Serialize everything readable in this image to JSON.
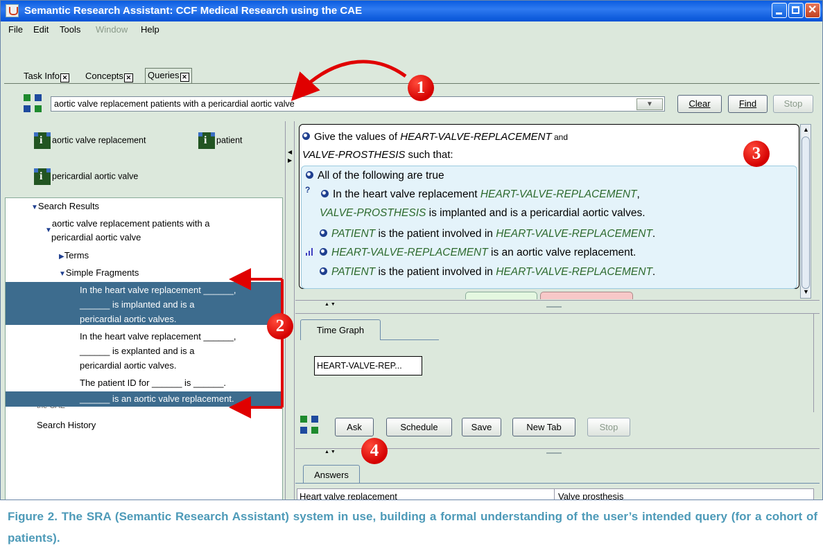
{
  "window": {
    "title": "Semantic Research Assistant: CCF Medical Research using the CAE"
  },
  "menu": [
    "File",
    "Edit",
    "Tools",
    "Window",
    "Help"
  ],
  "tabs": [
    "Task Info",
    "Concepts",
    "Queries"
  ],
  "query_bar": {
    "value": "aortic valve replacement  patients with a pericardial aortic valve",
    "dropdown_glyph": "▼",
    "clear_label": "Clear",
    "find_label": "Find",
    "stop_label": "Stop"
  },
  "concepts": [
    "aortic valve replacement",
    "patient",
    "pericardial aortic valve"
  ],
  "tree": {
    "search_results": "Search Results",
    "query_line1": "aortic valve replacement patients with a",
    "query_line2": "pericardial aortic valve",
    "terms": "Terms",
    "simple_fragments": "Simple Fragments",
    "frag1_line1": "In the heart valve replacement ______,",
    "frag1_line2": "______ is implanted and is a",
    "frag1_line3": "pericardial aortic valves.",
    "frag2_line1": "In the heart valve replacement ______,",
    "frag2_line2": "______ is explanted and is a",
    "frag2_line3": "pericardial aortic valves.",
    "frag3_line1": "The patient ID for ______ is ______.",
    "frag4_line1": "______ is an aortic valve replacement.",
    "partial_line": "the CAE",
    "search_history": "Search History"
  },
  "query_pane": {
    "intro_a": "Give the values of ",
    "intro_var1": "HEART-VALVE-REPLACEMENT",
    "intro_and": " and",
    "intro_var2": "VALVE-PROSTHESIS",
    "intro_such": " such that:",
    "all_true": "All of the following are true",
    "c1_a": "In the heart valve replacement ",
    "c1_var": "HEART-VALVE-REPLACEMENT",
    "c1_b": ",",
    "c1_var2": "VALVE-PROSTHESIS",
    "c1_c": " is implanted and is a pericardial aortic valves.",
    "c2_var": "PATIENT",
    "c2_a": " is the patient involved in ",
    "c2_var2": "HEART-VALVE-REPLACEMENT",
    "c2_b": ".",
    "c3_var": "HEART-VALVE-REPLACEMENT",
    "c3_a": " is an aortic valve replacement.",
    "c4_var": "PATIENT",
    "c4_a": " is the patient involved in ",
    "c4_var2": "HEART-VALVE-REPLACEMENT",
    "c4_b": ".",
    "question_mark": "?"
  },
  "time_graph": {
    "tab": "Time Graph",
    "node": "HEART-VALVE-REP..."
  },
  "actions": {
    "ask": "Ask",
    "schedule": "Schedule",
    "save": "Save",
    "new_tab": "New Tab",
    "stop": "Stop"
  },
  "answers": {
    "tab": "Answers",
    "columns": [
      "Heart valve replacement",
      "Valve prosthesis"
    ]
  },
  "annotations": [
    "1",
    "2",
    "3",
    "4"
  ],
  "caption": "Figure 2.  The SRA (Semantic Research Assistant) system in use, building a formal understanding of the user’s intended query (for a cohort of patients).",
  "colors": {
    "titlebar": "#0a5ce0",
    "selection": "#3d6c8e",
    "annotation": "#e00000",
    "caption": "#4d9ab8",
    "variable": "#2d6a2d"
  }
}
